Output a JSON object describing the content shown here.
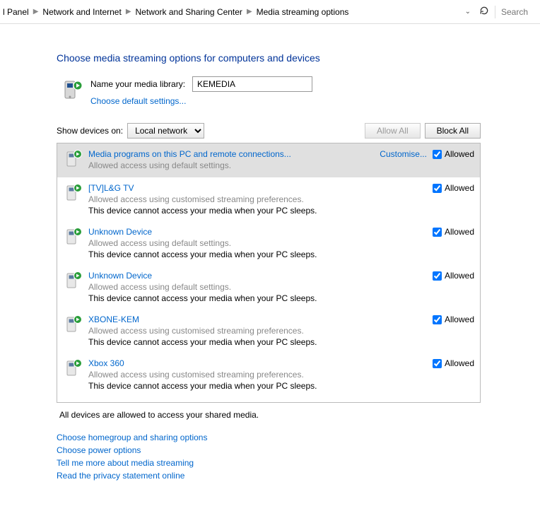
{
  "breadcrumb": {
    "items": [
      "l Panel",
      "Network and Internet",
      "Network and Sharing Center",
      "Media streaming options"
    ]
  },
  "search": {
    "placeholder": "Search"
  },
  "page": {
    "title": "Choose media streaming options for computers and devices",
    "libname_label": "Name your media library:",
    "libname_value": "KEMEDIA",
    "default_settings_link": "Choose default settings..."
  },
  "toolbar": {
    "show_label": "Show devices on:",
    "network_value": "Local network",
    "allow_all": "Allow All",
    "block_all": "Block All"
  },
  "devices": [
    {
      "name": "Media programs on this PC and remote connections...",
      "desc": "Allowed access using default settings.",
      "sleep": "",
      "customise": "Customise...",
      "allowed_label": "Allowed",
      "selected": true
    },
    {
      "name": "[TV]L&G TV",
      "desc": "Allowed access using customised streaming preferences.",
      "sleep": "This device cannot access your media when your PC sleeps.",
      "customise": "",
      "allowed_label": "Allowed",
      "selected": false
    },
    {
      "name": "Unknown Device",
      "desc": "Allowed access using default settings.",
      "sleep": "This device cannot access your media when your PC sleeps.",
      "customise": "",
      "allowed_label": "Allowed",
      "selected": false
    },
    {
      "name": "Unknown Device",
      "desc": "Allowed access using default settings.",
      "sleep": "This device cannot access your media when your PC sleeps.",
      "customise": "",
      "allowed_label": "Allowed",
      "selected": false
    },
    {
      "name": "XBONE-KEM",
      "desc": "Allowed access using customised streaming preferences.",
      "sleep": "This device cannot access your media when your PC sleeps.",
      "customise": "",
      "allowed_label": "Allowed",
      "selected": false
    },
    {
      "name": "Xbox 360",
      "desc": "Allowed access using customised streaming preferences.",
      "sleep": "This device cannot access your media when your PC sleeps.",
      "customise": "",
      "allowed_label": "Allowed",
      "selected": false
    }
  ],
  "status_line": "All devices are allowed to access your shared media.",
  "bottom_links": [
    "Choose homegroup and sharing options",
    "Choose power options",
    "Tell me more about media streaming",
    "Read the privacy statement online"
  ]
}
